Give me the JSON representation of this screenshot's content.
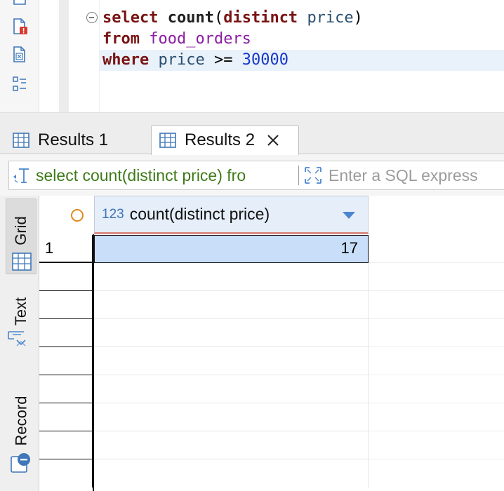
{
  "editor": {
    "lines": [
      {
        "kw1": "select",
        "fn": "count",
        "open": "(",
        "kw2": "distinct",
        "sp": " ",
        "col": "price",
        "close": ")"
      },
      {
        "kw": "from",
        "tbl": "food_orders"
      },
      {
        "kw": "where",
        "col": "price",
        "op": ">=",
        "num": "30000"
      }
    ]
  },
  "results_tabs": [
    {
      "label": "Results 1",
      "active": false
    },
    {
      "label": "Results 2",
      "active": true,
      "closable": true
    }
  ],
  "filter": {
    "query_text": "select count(distinct price) fro",
    "placeholder": "Enter a SQL express"
  },
  "view_modes": [
    {
      "label": "Grid",
      "active": true
    },
    {
      "label": "Text",
      "active": false
    },
    {
      "label": "Record",
      "active": false
    }
  ],
  "grid": {
    "column": {
      "type_label": "123",
      "name": "count(distinct price)"
    },
    "rows": [
      {
        "num": "1",
        "value": "17"
      }
    ]
  },
  "icons": {
    "editor_toolbar": [
      "sql-file-error-icon",
      "explain-plan-icon",
      "outline-icon"
    ],
    "tab": "grid-table-icon",
    "close": "close-icon",
    "filter": [
      "sql-text-icon",
      "expand-icon"
    ],
    "view_modes": [
      "grid-mode-icon",
      "text-mode-icon",
      "record-mode-icon"
    ]
  },
  "colors": {
    "keyword": "#7a1414",
    "table": "#8b1ca3",
    "number": "#1437c9",
    "filter_text": "#3d7a18",
    "selected_cell": "#c9def8",
    "header_bg": "#e6eefa"
  }
}
